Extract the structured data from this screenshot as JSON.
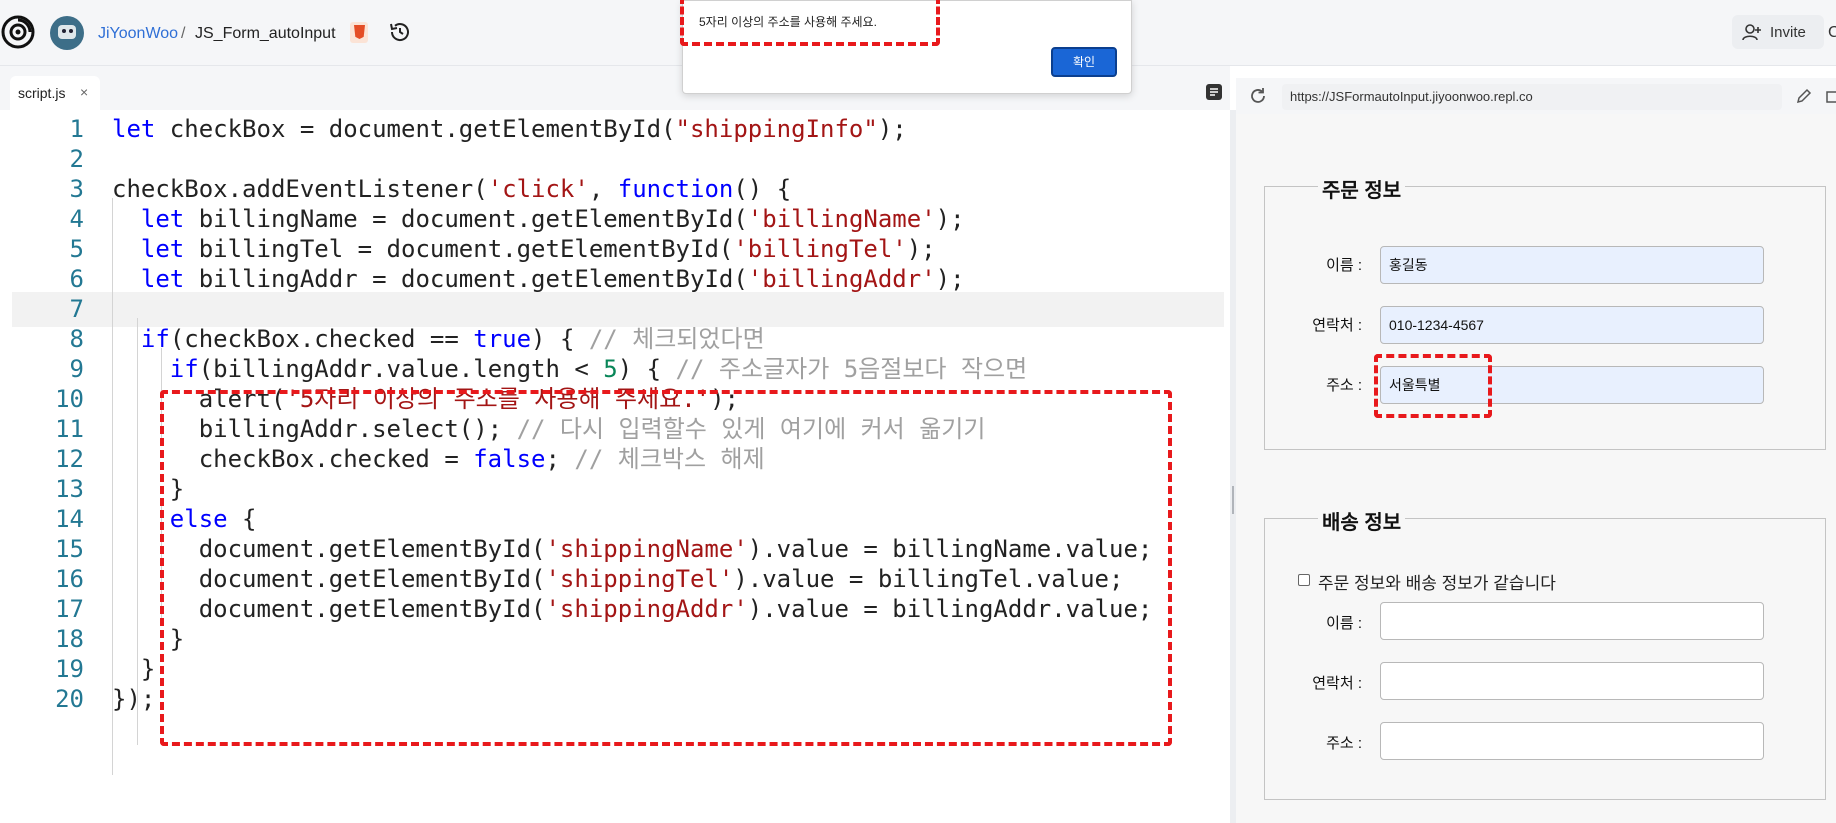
{
  "header": {
    "user": "JiYoonWoo",
    "separator": "/",
    "repo": "JS_Form_autoInput",
    "invite_label": "Invite",
    "edge_glyph": "C"
  },
  "alert": {
    "message": "5자리 이상의 주소를 사용해 주세요.",
    "ok_label": "확인"
  },
  "editor": {
    "tab_name": "script.js",
    "tab_close": "×",
    "lines": [
      {
        "n": "1",
        "parts": [
          [
            "kw",
            "let"
          ],
          [
            "p",
            " checkBox = document.getElementById("
          ],
          [
            "str",
            "\"shippingInfo\""
          ],
          [
            "p",
            ");"
          ]
        ]
      },
      {
        "n": "2",
        "parts": []
      },
      {
        "n": "3",
        "parts": [
          [
            "p",
            "checkBox.addEventListener("
          ],
          [
            "str",
            "'click'"
          ],
          [
            "p",
            ", "
          ],
          [
            "kw",
            "function"
          ],
          [
            "p",
            "() {"
          ]
        ]
      },
      {
        "n": "4",
        "parts": [
          [
            "p",
            "  "
          ],
          [
            "kw",
            "let"
          ],
          [
            "p",
            " billingName = document.getElementById("
          ],
          [
            "str",
            "'billingName'"
          ],
          [
            "p",
            ");"
          ]
        ]
      },
      {
        "n": "5",
        "parts": [
          [
            "p",
            "  "
          ],
          [
            "kw",
            "let"
          ],
          [
            "p",
            " billingTel = document.getElementById("
          ],
          [
            "str",
            "'billingTel'"
          ],
          [
            "p",
            ");"
          ]
        ]
      },
      {
        "n": "6",
        "parts": [
          [
            "p",
            "  "
          ],
          [
            "kw",
            "let"
          ],
          [
            "p",
            " billingAddr = document.getElementById("
          ],
          [
            "str",
            "'billingAddr'"
          ],
          [
            "p",
            ");"
          ]
        ]
      },
      {
        "n": "7",
        "parts": [],
        "active": true
      },
      {
        "n": "8",
        "parts": [
          [
            "p",
            "  "
          ],
          [
            "kw",
            "if"
          ],
          [
            "p",
            "(checkBox.checked == "
          ],
          [
            "kw",
            "true"
          ],
          [
            "p",
            ") { "
          ],
          [
            "cm",
            "// 체크되었다면"
          ]
        ]
      },
      {
        "n": "9",
        "parts": [
          [
            "p",
            "    "
          ],
          [
            "kw",
            "if"
          ],
          [
            "p",
            "(billingAddr.value.length < "
          ],
          [
            "num",
            "5"
          ],
          [
            "p",
            ") { "
          ],
          [
            "cm",
            "// 주소글자가 5음절보다 작으면"
          ]
        ]
      },
      {
        "n": "10",
        "parts": [
          [
            "p",
            "      alert("
          ],
          [
            "str",
            "'5자리 이상의 주소를 사용해 주세요.'"
          ],
          [
            "p",
            ");"
          ]
        ]
      },
      {
        "n": "11",
        "parts": [
          [
            "p",
            "      billingAddr.select(); "
          ],
          [
            "cm",
            "// 다시 입력할수 있게 여기에 커서 옮기기"
          ]
        ]
      },
      {
        "n": "12",
        "parts": [
          [
            "p",
            "      checkBox.checked = "
          ],
          [
            "kw",
            "false"
          ],
          [
            "p",
            "; "
          ],
          [
            "cm",
            "// 체크박스 해제"
          ]
        ]
      },
      {
        "n": "13",
        "parts": [
          [
            "p",
            "    }"
          ]
        ]
      },
      {
        "n": "14",
        "parts": [
          [
            "p",
            "    "
          ],
          [
            "kw",
            "else"
          ],
          [
            "p",
            " {"
          ]
        ]
      },
      {
        "n": "15",
        "parts": [
          [
            "p",
            "      document.getElementById("
          ],
          [
            "str",
            "'shippingName'"
          ],
          [
            "p",
            ").value = billingName.value;"
          ]
        ]
      },
      {
        "n": "16",
        "parts": [
          [
            "p",
            "      document.getElementById("
          ],
          [
            "str",
            "'shippingTel'"
          ],
          [
            "p",
            ").value = billingTel.value;"
          ]
        ]
      },
      {
        "n": "17",
        "parts": [
          [
            "p",
            "      document.getElementById("
          ],
          [
            "str",
            "'shippingAddr'"
          ],
          [
            "p",
            ").value = billingAddr.value;"
          ]
        ]
      },
      {
        "n": "18",
        "parts": [
          [
            "p",
            "    }"
          ]
        ]
      },
      {
        "n": "19",
        "parts": [
          [
            "p",
            "  }"
          ]
        ]
      },
      {
        "n": "20",
        "parts": [
          [
            "p",
            "});"
          ]
        ]
      }
    ]
  },
  "preview": {
    "url": "https://JSFormautoInput.jiyoonwoo.repl.co",
    "order": {
      "legend": "주문 정보",
      "name_label": "이름 :",
      "name_value": "홍길동",
      "tel_label": "연락처 :",
      "tel_value": "010-1234-4567",
      "addr_label": "주소 :",
      "addr_value": "서울특별"
    },
    "shipping": {
      "legend": "배송 정보",
      "same_label": "주문 정보와 배송 정보가 같습니다",
      "same_checked": false,
      "name_label": "이름 :",
      "name_value": "",
      "tel_label": "연락처 :",
      "tel_value": "",
      "addr_label": "주소 :",
      "addr_value": ""
    }
  },
  "colors": {
    "keyword": "#0000ff",
    "string": "#a31515",
    "number": "#098658",
    "comment": "#a0a0a0",
    "line_number": "#237893",
    "annotation": "#e8191c",
    "ok_button": "#1a66d6",
    "autofill": "#e8f0fe"
  }
}
